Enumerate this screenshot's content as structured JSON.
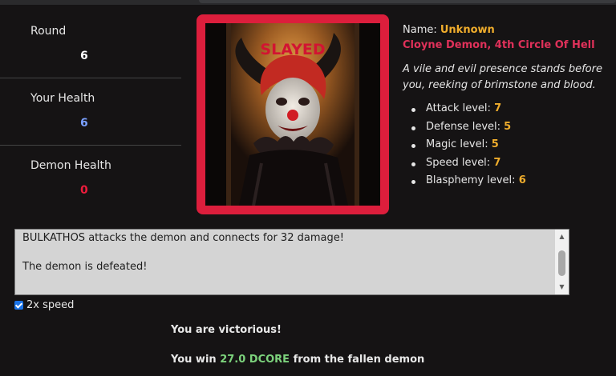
{
  "stats": [
    {
      "label": "Round",
      "value": "6",
      "color": "#ffffff"
    },
    {
      "label": "Your Health",
      "value": "6",
      "color": "#7aa0ff"
    },
    {
      "label": "Demon Health",
      "value": "0",
      "color": "#ee1c3c"
    }
  ],
  "portrait": {
    "overlay": "SLAYED",
    "frame_color": "#dc1e3c"
  },
  "demon": {
    "name_label": "Name:",
    "name_value": "Unknown",
    "title": "Cloyne Demon, 4th Circle Of Hell",
    "description": "A vile and evil presence stands before you, reeking of brimstone and blood.",
    "attributes": [
      {
        "label": "Attack level:",
        "value": "7"
      },
      {
        "label": "Defense level:",
        "value": "5"
      },
      {
        "label": "Magic level:",
        "value": "5"
      },
      {
        "label": "Speed level:",
        "value": "7"
      },
      {
        "label": "Blasphemy level:",
        "value": "6"
      }
    ]
  },
  "battle_log": {
    "lines": [
      "BULKATHOS attacks the demon and connects for 32 damage!",
      "The demon is defeated!"
    ]
  },
  "speed_toggle": {
    "label": "2x speed",
    "checked": true
  },
  "result": {
    "victory": "You are victorious!",
    "reward_prefix": "You win ",
    "reward_amount": "27.0 DCORE",
    "reward_suffix": " from the fallen demon"
  },
  "colors": {
    "accent_gold": "#f0ad2c",
    "accent_red": "#e0315a",
    "reward_green": "#7cd27c"
  }
}
